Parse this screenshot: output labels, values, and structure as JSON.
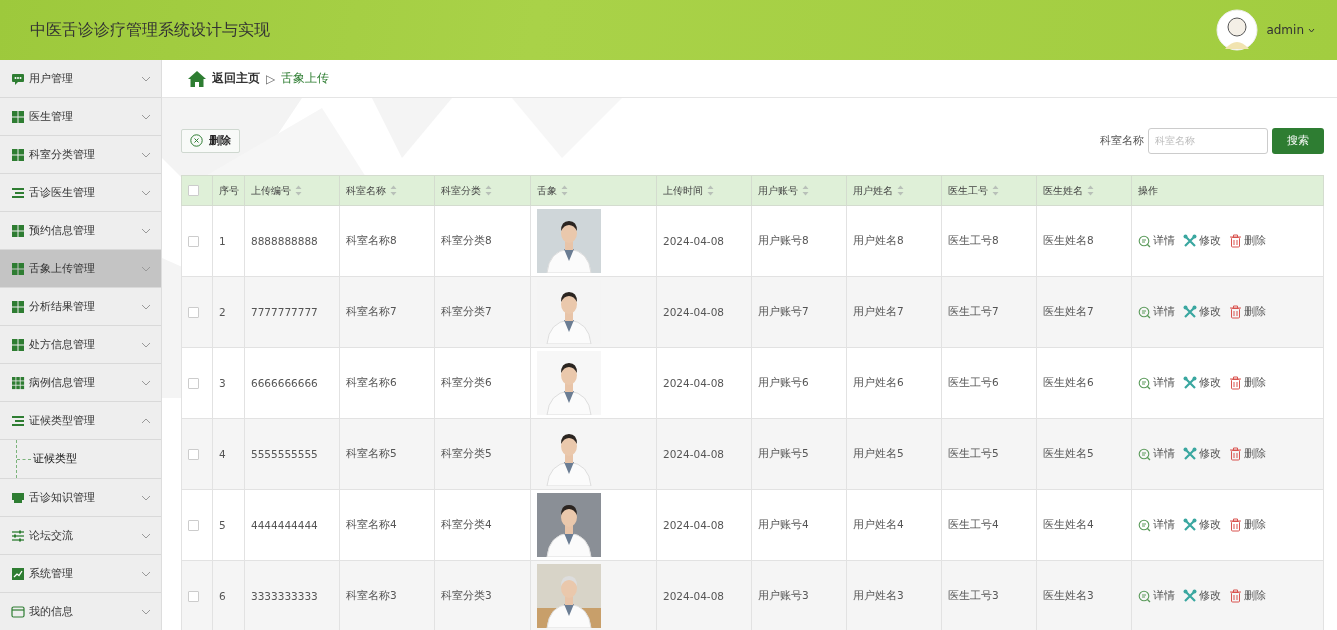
{
  "header": {
    "title": "中医舌诊诊疗管理系统设计与实现",
    "user": "admin"
  },
  "sidebar": {
    "items": [
      {
        "label": "用户管理",
        "kind": "chat",
        "selected": false,
        "expanded": false
      },
      {
        "label": "医生管理",
        "kind": "grid",
        "selected": false,
        "expanded": false
      },
      {
        "label": "科室分类管理",
        "kind": "grid",
        "selected": false,
        "expanded": false
      },
      {
        "label": "舌诊医生管理",
        "kind": "list",
        "selected": false,
        "expanded": false
      },
      {
        "label": "预约信息管理",
        "kind": "grid",
        "selected": false,
        "expanded": false
      },
      {
        "label": "舌象上传管理",
        "kind": "grid",
        "selected": true,
        "expanded": false
      },
      {
        "label": "分析结果管理",
        "kind": "grid",
        "selected": false,
        "expanded": false
      },
      {
        "label": "处方信息管理",
        "kind": "grid",
        "selected": false,
        "expanded": false
      },
      {
        "label": "病例信息管理",
        "kind": "grid9",
        "selected": false,
        "expanded": false
      },
      {
        "label": "证候类型管理",
        "kind": "list",
        "selected": false,
        "expanded": true,
        "children": [
          {
            "label": "证候类型",
            "selected": false
          }
        ]
      },
      {
        "label": "舌诊知识管理",
        "kind": "shop",
        "selected": false,
        "expanded": false
      },
      {
        "label": "论坛交流",
        "kind": "sliders",
        "selected": false,
        "expanded": false
      },
      {
        "label": "系统管理",
        "kind": "chart",
        "selected": false,
        "expanded": false
      },
      {
        "label": "我的信息",
        "kind": "card",
        "selected": false,
        "expanded": false
      }
    ]
  },
  "breadcrumb": {
    "home": "返回主页",
    "separator": "▷",
    "current": "舌象上传"
  },
  "toolbar": {
    "delete_button": "删除",
    "search_label": "科室名称",
    "search_placeholder": "科室名称",
    "search_button": "搜索"
  },
  "table": {
    "all_checked": false,
    "columns": [
      {
        "label": "序号",
        "sortable": false
      },
      {
        "label": "上传编号",
        "sortable": true
      },
      {
        "label": "科室名称",
        "sortable": true
      },
      {
        "label": "科室分类",
        "sortable": true
      },
      {
        "label": "舌象",
        "sortable": true
      },
      {
        "label": "上传时间",
        "sortable": true
      },
      {
        "label": "用户账号",
        "sortable": true
      },
      {
        "label": "用户姓名",
        "sortable": true
      },
      {
        "label": "医生工号",
        "sortable": true
      },
      {
        "label": "医生姓名",
        "sortable": true
      },
      {
        "label": "操作",
        "sortable": false
      }
    ],
    "rows": [
      {
        "checked": false,
        "cells": [
          "1",
          "8888888888",
          "科室名称8",
          "科室分类8",
          {
            "kind": "picture"
          },
          "2024-04-08",
          "用户账号8",
          "用户姓名8",
          "医生工号8",
          "医生姓名8"
        ],
        "actions": [
          "详情",
          "修改",
          "删除"
        ]
      },
      {
        "checked": false,
        "cells": [
          "2",
          "7777777777",
          "科室名称7",
          "科室分类7",
          {
            "kind": "picture"
          },
          "2024-04-08",
          "用户账号7",
          "用户姓名7",
          "医生工号7",
          "医生姓名7"
        ],
        "actions": [
          "详情",
          "修改",
          "删除"
        ]
      },
      {
        "checked": false,
        "cells": [
          "3",
          "6666666666",
          "科室名称6",
          "科室分类6",
          {
            "kind": "picture"
          },
          "2024-04-08",
          "用户账号6",
          "用户姓名6",
          "医生工号6",
          "医生姓名6"
        ],
        "actions": [
          "详情",
          "修改",
          "删除"
        ]
      },
      {
        "checked": false,
        "cells": [
          "4",
          "5555555555",
          "科室名称5",
          "科室分类5",
          {
            "kind": "picture"
          },
          "2024-04-08",
          "用户账号5",
          "用户姓名5",
          "医生工号5",
          "医生姓名5"
        ],
        "actions": [
          "详情",
          "修改",
          "删除"
        ]
      },
      {
        "checked": false,
        "cells": [
          "5",
          "4444444444",
          "科室名称4",
          "科室分类4",
          {
            "kind": "picture"
          },
          "2024-04-08",
          "用户账号4",
          "用户姓名4",
          "医生工号4",
          "医生姓名4"
        ],
        "actions": [
          "详情",
          "修改",
          "删除"
        ]
      },
      {
        "checked": false,
        "cells": [
          "6",
          "3333333333",
          "科室名称3",
          "科室分类3",
          {
            "kind": "picture"
          },
          "2024-04-08",
          "用户账号3",
          "用户姓名3",
          "医生工号3",
          "医生姓名3"
        ],
        "actions": [
          "详情",
          "修改",
          "删除"
        ]
      }
    ]
  }
}
